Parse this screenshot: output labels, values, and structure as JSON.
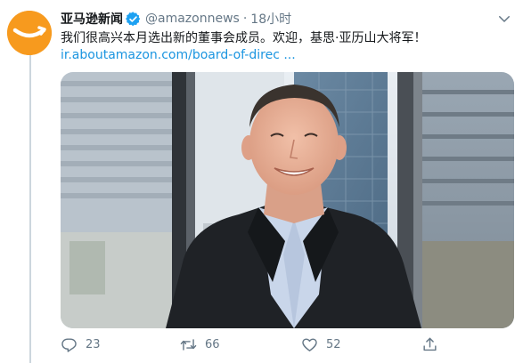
{
  "tweet": {
    "display_name": "亚马逊新闻",
    "handle": "@amazonnews",
    "separator": "·",
    "time": "18小时",
    "text": "我们很高兴本月选出新的董事会成员。欢迎，基思·亚历山大将军！",
    "link": "ir.aboutamazon.com/board-of-direc ...",
    "verified": true
  },
  "actions": {
    "reply_count": "23",
    "retweet_count": "66",
    "like_count": "52"
  },
  "icons": {
    "avatar": "amazon-smile-logo",
    "verified": "verified-badge-icon",
    "caret": "chevron-down-icon",
    "reply": "reply-icon",
    "retweet": "retweet-icon",
    "like": "heart-icon",
    "share": "share-icon"
  },
  "colors": {
    "avatar_bg": "#f79a1e",
    "verified": "#1da1f2",
    "link": "#1b95e0",
    "muted": "#657786",
    "text": "#14171a"
  }
}
